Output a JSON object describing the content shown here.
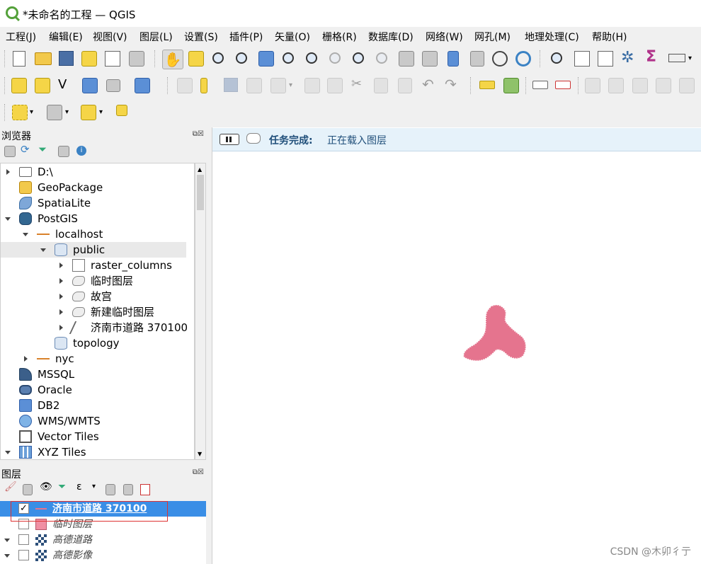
{
  "window": {
    "title": "*未命名的工程 — QGIS"
  },
  "menubar": [
    "工程(J)",
    "编辑(E)",
    "视图(V)",
    "图层(L)",
    "设置(S)",
    "插件(P)",
    "矢量(O)",
    "栅格(R)",
    "数据库(D)",
    "网络(W)",
    "网孔(M)",
    "地理处理(C)",
    "帮助(H)"
  ],
  "browser": {
    "title": "浏览器",
    "tree": [
      {
        "label": "D:\\",
        "level": 0,
        "arrow": "right",
        "icon": "folder-icon"
      },
      {
        "label": "GeoPackage",
        "level": 0,
        "arrow": "none",
        "icon": "geopackage-icon"
      },
      {
        "label": "SpatiaLite",
        "level": 0,
        "arrow": "none",
        "icon": "spatialite-icon"
      },
      {
        "label": "PostGIS",
        "level": 0,
        "arrow": "down",
        "icon": "postgis-elephant-icon"
      },
      {
        "label": "localhost",
        "level": 1,
        "arrow": "down",
        "icon": "connection-icon"
      },
      {
        "label": "public",
        "level": 2,
        "arrow": "down",
        "icon": "database-schema-icon",
        "selected": true
      },
      {
        "label": "raster_columns",
        "level": 3,
        "arrow": "right",
        "icon": "table-icon"
      },
      {
        "label": "临时图层",
        "level": 3,
        "arrow": "right",
        "icon": "polygon-layer-icon"
      },
      {
        "label": "故宫",
        "level": 3,
        "arrow": "right",
        "icon": "polygon-layer-icon"
      },
      {
        "label": "新建临时图层",
        "level": 3,
        "arrow": "right",
        "icon": "polygon-layer-icon"
      },
      {
        "label": "济南市道路 370100",
        "level": 3,
        "arrow": "right",
        "icon": "line-layer-icon"
      },
      {
        "label": "topology",
        "level": 2,
        "arrow": "none",
        "icon": "database-schema-icon"
      },
      {
        "label": "nyc",
        "level": 1,
        "arrow": "right",
        "icon": "connection-icon"
      },
      {
        "label": "MSSQL",
        "level": 0,
        "arrow": "none",
        "icon": "mssql-icon"
      },
      {
        "label": "Oracle",
        "level": 0,
        "arrow": "none",
        "icon": "oracle-icon"
      },
      {
        "label": "DB2",
        "level": 0,
        "arrow": "none",
        "icon": "db2-icon"
      },
      {
        "label": "WMS/WMTS",
        "level": 0,
        "arrow": "none",
        "icon": "globe-icon"
      },
      {
        "label": "Vector Tiles",
        "level": 0,
        "arrow": "none",
        "icon": "vector-tiles-icon"
      },
      {
        "label": "XYZ Tiles",
        "level": 0,
        "arrow": "down",
        "icon": "xyz-tiles-icon"
      }
    ]
  },
  "layers": {
    "title": "图层",
    "items": [
      {
        "label": "济南市道路 370100",
        "checked": true,
        "selected": true,
        "italic": false,
        "arrow": "none",
        "swatch": "#e5748e",
        "swatch_type": "line"
      },
      {
        "label": "临时图层",
        "checked": false,
        "selected": false,
        "italic": true,
        "arrow": "none",
        "swatch": "#f08fa3",
        "swatch_type": "fill"
      },
      {
        "label": "高德道路",
        "checked": false,
        "selected": false,
        "italic": true,
        "arrow": "down",
        "swatch": "#2c4f7a",
        "swatch_type": "raster"
      },
      {
        "label": "高德影像",
        "checked": false,
        "selected": false,
        "italic": true,
        "arrow": "down",
        "swatch": "#2c4f7a",
        "swatch_type": "raster"
      }
    ]
  },
  "message_bar": {
    "label": "任务完成:",
    "text": "正在载入图层"
  },
  "map": {
    "feature_color": "#e5748e"
  },
  "watermark": "CSDN @木卯彳亍",
  "colors": {
    "selection": "#3a8ee6",
    "msgbar_bg": "#e6f2fa",
    "accent": "#54a13a"
  }
}
